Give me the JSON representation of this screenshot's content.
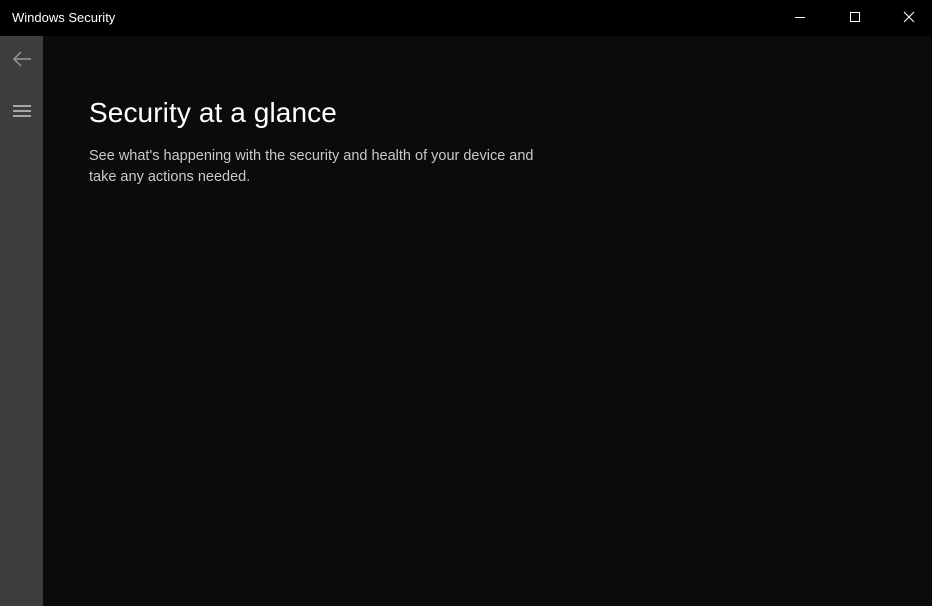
{
  "window": {
    "title": "Windows Security"
  },
  "caption_buttons": {
    "minimize_icon": "minimize-icon",
    "maximize_icon": "maximize-icon",
    "close_icon": "close-icon"
  },
  "sidebar": {
    "back_icon": "back-arrow-icon",
    "menu_icon": "hamburger-menu-icon"
  },
  "main": {
    "title": "Security at a glance",
    "subtitle": "See what's happening with the security and health of your device and take any actions needed."
  },
  "colors": {
    "titlebar_bg": "#000000",
    "content_bg": "#0b0b0b",
    "sidebar_bg": "#3d3d3d",
    "text_primary": "#ffffff",
    "text_secondary": "#c9c9c9"
  }
}
